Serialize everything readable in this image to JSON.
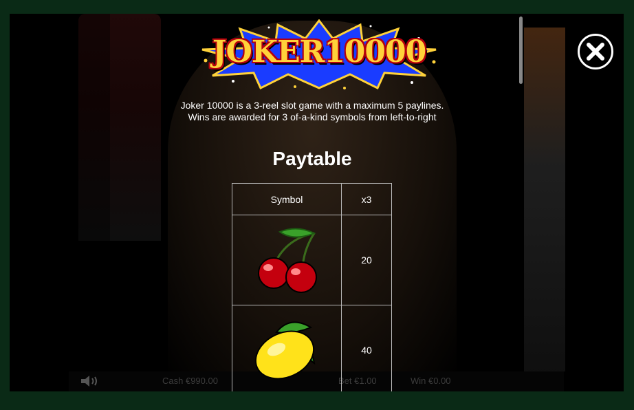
{
  "game": {
    "logo_text": "JOKER10000",
    "intro_line1": "Joker 10000 is a 3-reel slot game with a maximum 5 paylines.",
    "intro_line2": "Wins are awarded for 3 of-a-kind symbols from left-to-right"
  },
  "paytable": {
    "title": "Paytable",
    "columns": [
      "Symbol",
      "x3"
    ],
    "rows": [
      {
        "symbol": "cherries",
        "x3": "20"
      },
      {
        "symbol": "lemon",
        "x3": "40"
      }
    ]
  },
  "background_status": {
    "cash": "Cash €990.00",
    "bet": "Bet €1.00",
    "win": "Win €0.00"
  },
  "colors": {
    "outer_frame": "#0a2a16",
    "logo_yellow": "#ffd23a",
    "logo_red": "#b5000e",
    "star_blue": "#1a3cff"
  }
}
